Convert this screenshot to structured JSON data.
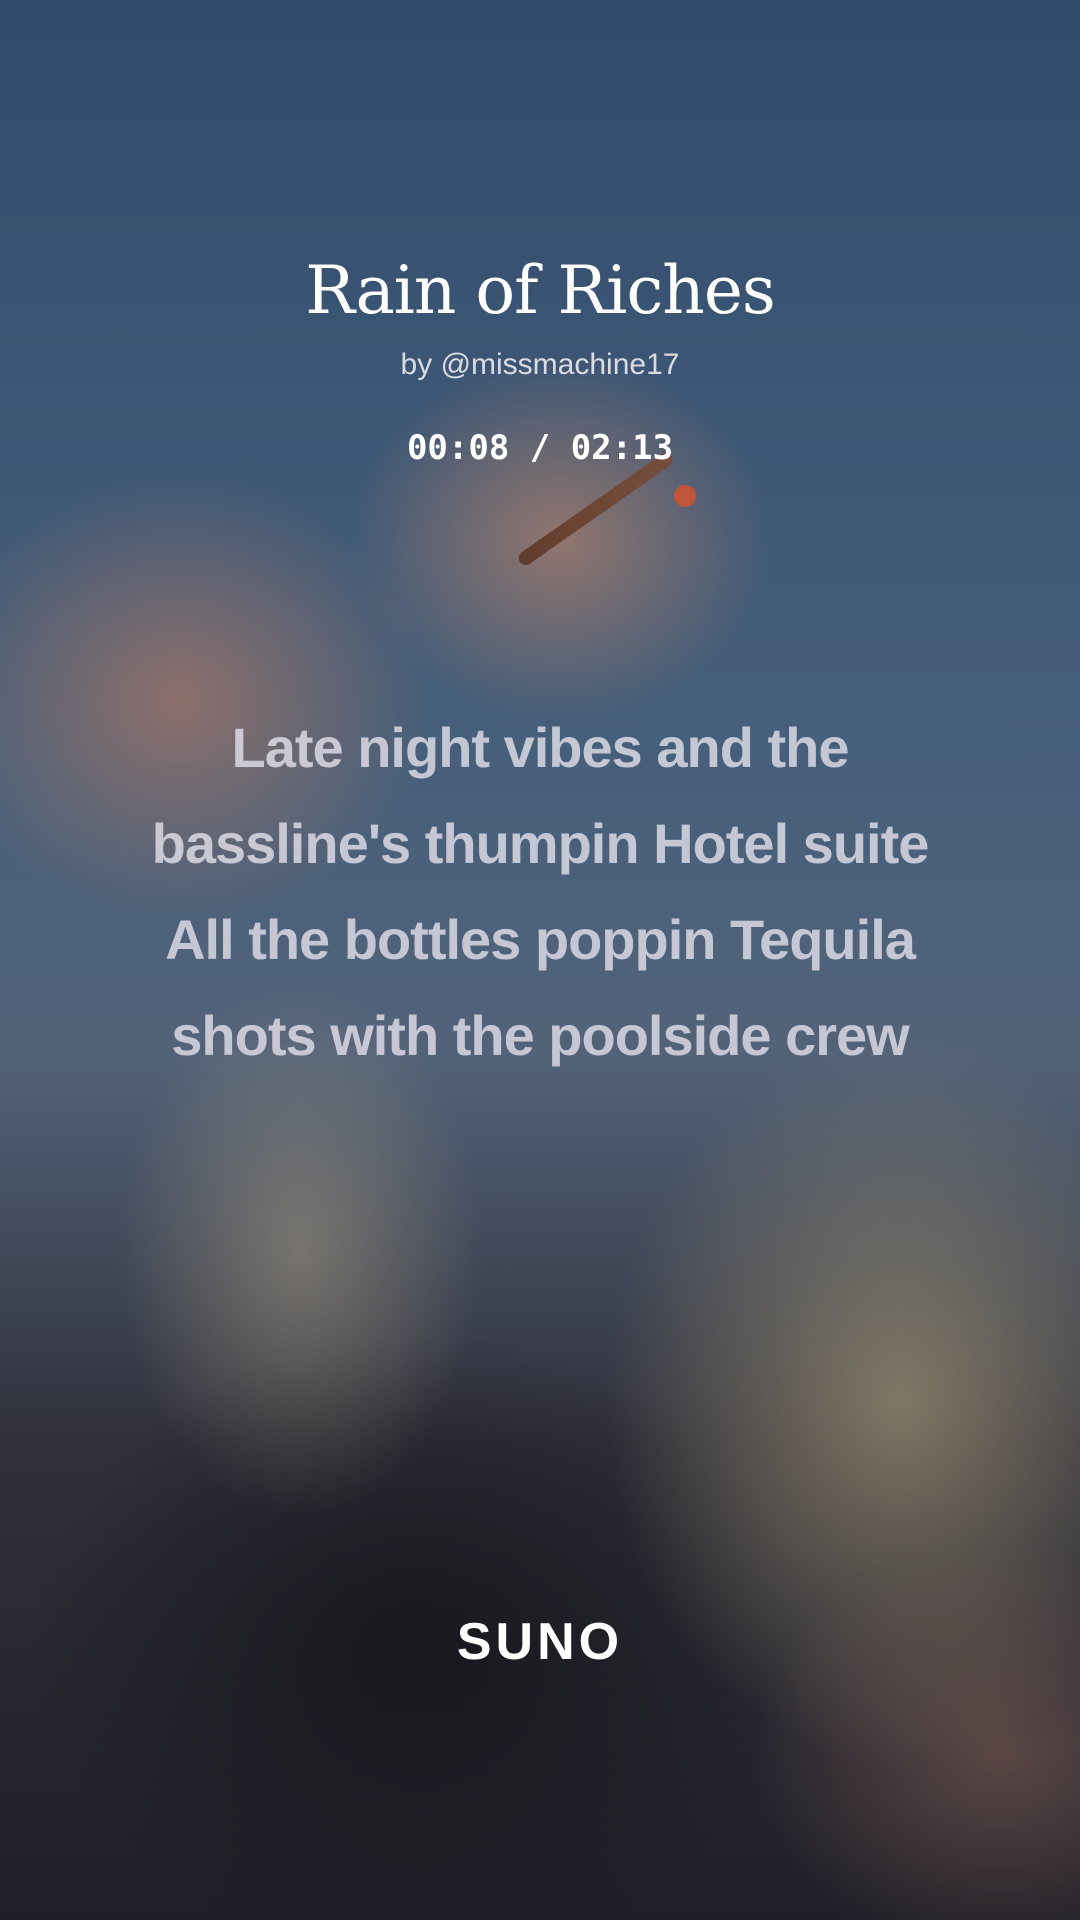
{
  "song": {
    "title": "Rain of Riches",
    "artist": "by @missmachine17"
  },
  "playback": {
    "elapsed": "00:08",
    "duration": "02:13",
    "timecode": "00:08 / 02:13"
  },
  "lyrics": {
    "lines": [
      "Late night vibes and the",
      "bassline's thumpin Hotel suite",
      "All the bottles poppin Tequila",
      "shots with the poolside crew"
    ]
  },
  "branding": {
    "logo_text": "SUNO"
  }
}
